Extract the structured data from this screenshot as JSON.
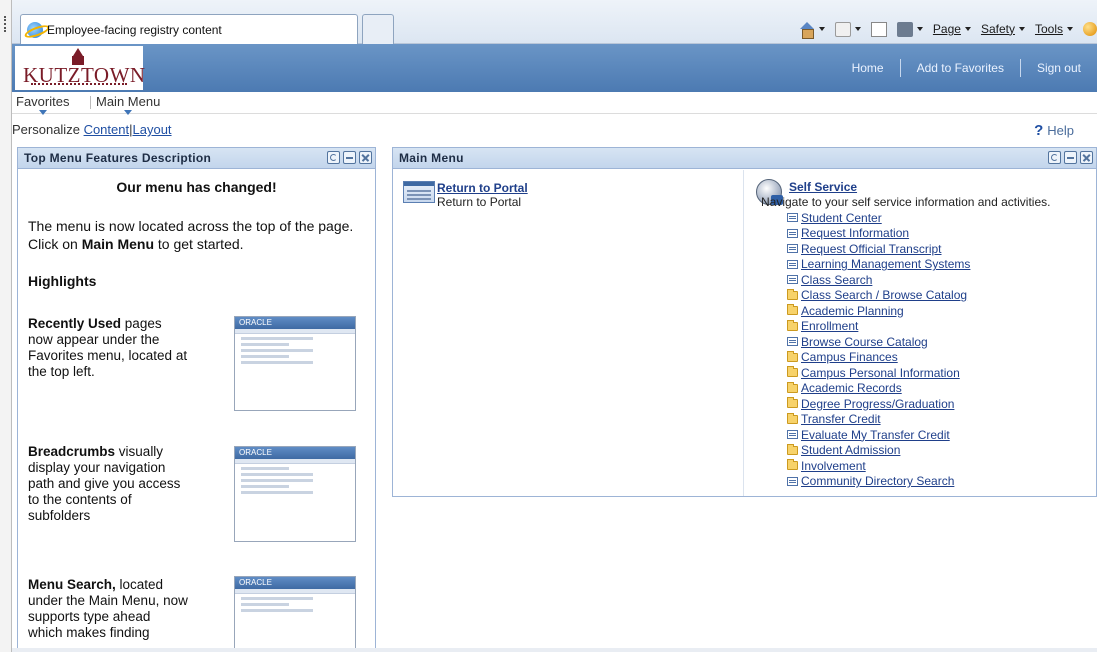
{
  "browser": {
    "tab_title": "Employee-facing registry content",
    "commands": [
      {
        "label": "Page",
        "icon": "page-icon"
      },
      {
        "label": "Safety",
        "icon": "safety-icon"
      },
      {
        "label": "Tools",
        "icon": "tools-icon"
      }
    ],
    "icons": [
      "home-icon",
      "feeds-icon",
      "read-mail-icon",
      "print-icon",
      "help-icon"
    ]
  },
  "header": {
    "logo_text": "KUTZTOWN",
    "links": [
      "Home",
      "Add to Favorites",
      "Sign out"
    ],
    "banner_color": "#5a86bd",
    "logo_color": "#7a1c28"
  },
  "nav": {
    "favorites": "Favorites",
    "main_menu": "Main Menu"
  },
  "personalize": {
    "label": "Personalize",
    "content": "Content",
    "separator": "|",
    "layout": "Layout",
    "help": "Help"
  },
  "left_pagelet": {
    "title": "Top Menu Features Description",
    "heading": "Our menu has changed!",
    "intro_1": "The menu is now located across the top of the page. Click on ",
    "intro_bold": "Main Menu",
    "intro_2": " to get started.",
    "highlights": "Highlights",
    "features": [
      {
        "bold": "Recently Used",
        "text": " pages now appear under the Favorites menu, located at the top left."
      },
      {
        "bold": "Breadcrumbs",
        "text": " visually display your navigation path and give you access to the contents of subfolders"
      },
      {
        "bold": "Menu Search,",
        "text": " located under the Main Menu, now supports type ahead which makes finding"
      }
    ],
    "thumb_label": "ORACLE"
  },
  "main_menu": {
    "title": "Main Menu",
    "return_link": "Return to Portal",
    "return_desc": "Return to Portal",
    "self_service": "Self Service",
    "self_service_desc": "Navigate to your self service information and activities.",
    "items": [
      {
        "label": "Student Center",
        "icon": "page"
      },
      {
        "label": "Request Information",
        "icon": "page"
      },
      {
        "label": "Request Official Transcript",
        "icon": "page"
      },
      {
        "label": "Learning Management Systems",
        "icon": "page"
      },
      {
        "label": "Class Search",
        "icon": "page"
      },
      {
        "label": "Class Search / Browse Catalog",
        "icon": "folder"
      },
      {
        "label": "Academic Planning",
        "icon": "folder"
      },
      {
        "label": "Enrollment",
        "icon": "folder"
      },
      {
        "label": "Browse Course Catalog",
        "icon": "page"
      },
      {
        "label": "Campus Finances",
        "icon": "folder"
      },
      {
        "label": "Campus Personal Information",
        "icon": "folder"
      },
      {
        "label": "Academic Records",
        "icon": "folder"
      },
      {
        "label": "Degree Progress/Graduation",
        "icon": "folder"
      },
      {
        "label": "Transfer Credit",
        "icon": "folder"
      },
      {
        "label": "Evaluate My Transfer Credit",
        "icon": "page"
      },
      {
        "label": "Student Admission",
        "icon": "folder"
      },
      {
        "label": "Involvement",
        "icon": "folder"
      },
      {
        "label": "Community Directory Search",
        "icon": "page"
      }
    ]
  }
}
